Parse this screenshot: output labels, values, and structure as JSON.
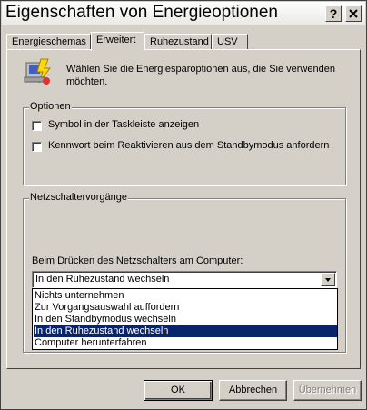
{
  "window": {
    "title": "Eigenschaften von Energieoptionen",
    "help_button": "?",
    "close_button": "X"
  },
  "tabs": [
    {
      "label": "Energieschemas",
      "active": false
    },
    {
      "label": "Erweitert",
      "active": true
    },
    {
      "label": "Ruhezustand",
      "active": false
    },
    {
      "label": "USV",
      "active": false
    }
  ],
  "intro": {
    "icon": "power-options-icon",
    "text_line1": "Wählen Sie die Energiesparoptionen aus, die Sie verwenden",
    "text_line2": "möchten."
  },
  "options_group": {
    "legend": "Optionen",
    "checkboxes": [
      {
        "label": "Symbol in der Taskleiste anzeigen",
        "checked": false
      },
      {
        "label": "Kennwort beim Reaktivieren aus dem Standbymodus anfordern",
        "checked": false
      }
    ]
  },
  "power_button_group": {
    "legend": "Netzschaltervorgänge",
    "prompt": "Beim Drücken des Netzschalters am Computer:",
    "selected": "In den Ruhezustand wechseln",
    "options": [
      "Nichts unternehmen",
      "Zur Vorgangsauswahl auffordern",
      "In den Standbymodus wechseln",
      "In den Ruhezustand wechseln",
      "Computer herunterfahren"
    ],
    "highlighted_index": 3
  },
  "buttons": {
    "ok": "OK",
    "cancel": "Abbrechen",
    "apply": "Übernehmen"
  }
}
